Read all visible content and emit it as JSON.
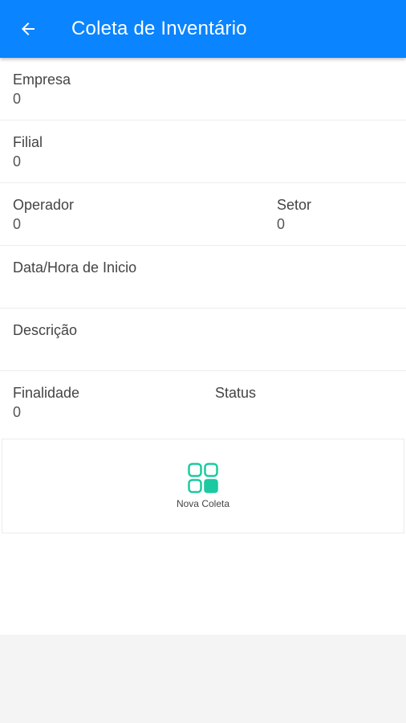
{
  "header": {
    "title": "Coleta de Inventário",
    "back_icon": "arrow-left-icon",
    "color": "#0a84ff"
  },
  "fields": {
    "empresa": {
      "label": "Empresa",
      "value": "0"
    },
    "filial": {
      "label": "Filial",
      "value": "0"
    },
    "operador": {
      "label": "Operador",
      "value": "0"
    },
    "setor": {
      "label": "Setor",
      "value": "0"
    },
    "data_hora": {
      "label": "Data/Hora de Inicio",
      "value": ""
    },
    "descricao": {
      "label": "Descrição",
      "value": ""
    },
    "finalidade": {
      "label": "Finalidade",
      "value": "0"
    },
    "status": {
      "label": "Status",
      "value": ""
    }
  },
  "action": {
    "label": "Nova Coleta",
    "icon": "grid-icon",
    "color": "#1cc9a0"
  }
}
